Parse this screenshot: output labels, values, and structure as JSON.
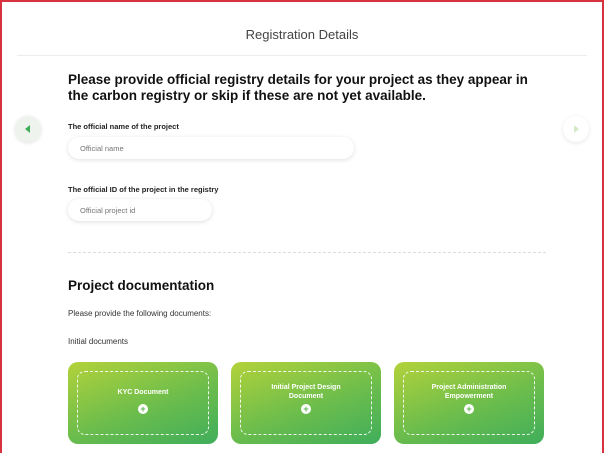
{
  "header": {
    "title": "Registration Details"
  },
  "nav": {
    "prev_icon": "chevron-left-icon",
    "next_icon": "chevron-right-icon"
  },
  "intro": {
    "text": "Please provide official registry details for your project as they appear in the carbon registry or skip if these are not yet available."
  },
  "fields": {
    "official_name": {
      "label": "The official name of the project",
      "placeholder": "Official name",
      "value": ""
    },
    "official_id": {
      "label": "The official ID of the project in the registry",
      "placeholder": "Official project id",
      "value": ""
    }
  },
  "documentation": {
    "title": "Project documentation",
    "subtitle": "Please provide the following documents:",
    "group_label": "Initial documents",
    "cards": [
      {
        "label": "KYC Document",
        "icon": "plus-icon"
      },
      {
        "label": "Initial Project Design Document",
        "icon": "plus-icon"
      },
      {
        "label": "Project Administration Empowerment",
        "icon": "plus-icon"
      }
    ]
  },
  "colors": {
    "frame_border": "#d9323f",
    "card_gradient_start": "#b3d23a",
    "card_gradient_end": "#3fae5b"
  }
}
